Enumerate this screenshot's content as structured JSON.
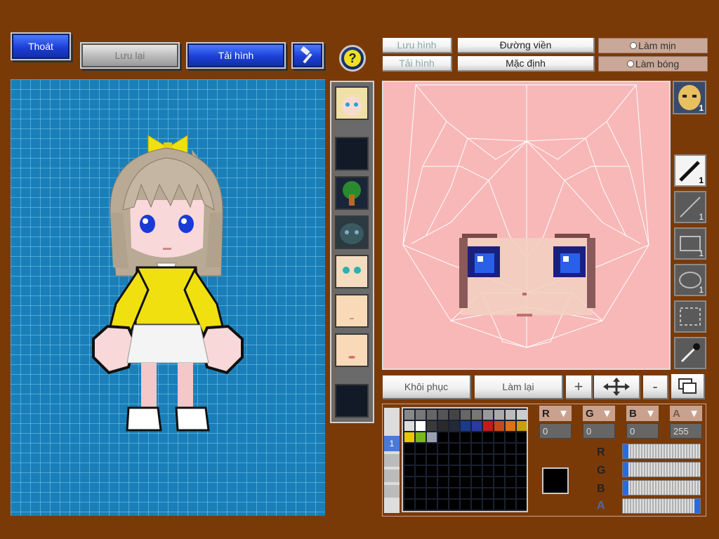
{
  "toolbar": {
    "exit_label": "Thoát",
    "save_label": "Lưu lại",
    "reload_label": "Tải hình"
  },
  "editor_tabs": {
    "save_image": "Lưu hình",
    "load_image": "Tải hình",
    "outline": "Đường viền",
    "default": "Mặc định",
    "smooth": "Làm mịn",
    "shade": "Làm bóng"
  },
  "actions": {
    "restore": "Khôi phục",
    "redo": "Làm lại",
    "plus": "+",
    "minus": "-"
  },
  "tools": {
    "pen_size": "1",
    "line_size": "1",
    "rect_size": "1",
    "ellipse_size": "1",
    "face_badge": "1"
  },
  "palette_tab": "1",
  "color": {
    "r_label": "R",
    "g_label": "G",
    "b_label": "B",
    "a_label": "A",
    "r": "0",
    "g": "0",
    "b": "0",
    "a": "255",
    "current_hex": "#000000",
    "slider_r": 0,
    "slider_g": 0,
    "slider_b": 0,
    "slider_a": 1
  },
  "palette_colors": [
    "#888888",
    "#777777",
    "#666666",
    "#555555",
    "#444444",
    "#666666",
    "#777777",
    "#999999",
    "#aaaaaa",
    "#bbbbbb",
    "#cccccc",
    "#dddddd",
    "#ffffff",
    "#3a3a3a",
    "#2a2a2a",
    "#222a3a",
    "#1a3a8a",
    "#2a3aa0",
    "#c81818",
    "#c84818",
    "#e07010",
    "#c8a000",
    "#e8c800",
    "#78b818",
    "#9aa0b0"
  ],
  "colors": {
    "background": "#7a3a08",
    "viewport": "#1a7fb8",
    "texture_bg": "#f8b8b8"
  }
}
